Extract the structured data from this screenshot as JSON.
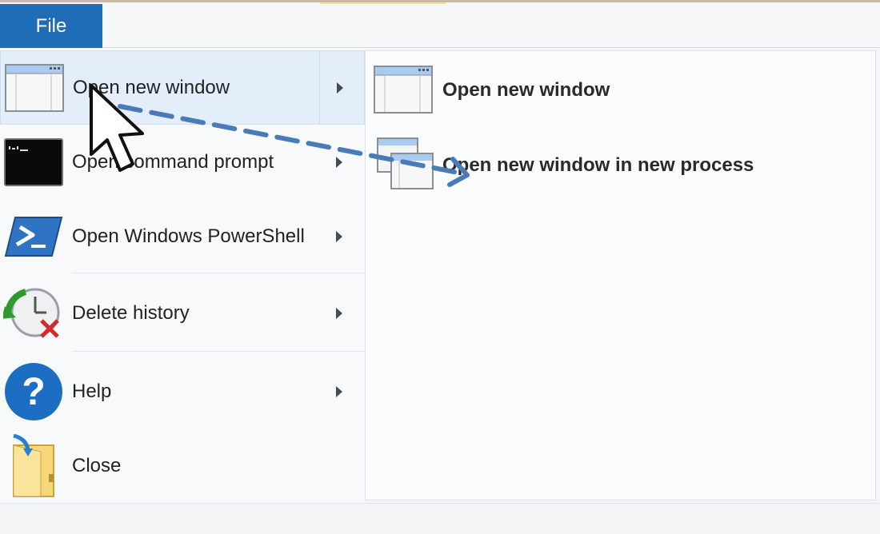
{
  "ribbon": {
    "file_tab": "File"
  },
  "menu": {
    "items": [
      {
        "label": "Open new window",
        "icon": "window-icon",
        "has_submenu": true
      },
      {
        "label": "Open command prompt",
        "icon": "command-prompt-icon",
        "has_submenu": true
      },
      {
        "label": "Open Windows PowerShell",
        "icon": "powershell-icon",
        "has_submenu": true
      },
      {
        "label": "Delete history",
        "icon": "delete-history-icon",
        "has_submenu": true
      },
      {
        "label": "Help",
        "icon": "help-icon",
        "has_submenu": true
      },
      {
        "label": "Close",
        "icon": "close-folder-icon",
        "has_submenu": false
      }
    ]
  },
  "submenu": {
    "items": [
      {
        "label": "Open new window",
        "icon": "window-icon"
      },
      {
        "label": "Open new window in new process",
        "icon": "multiple-windows-icon"
      }
    ]
  },
  "colors": {
    "file_tab": "#1e6db6",
    "hover": "#e3eefa",
    "annotation_arrow": "#4a7ab8"
  }
}
